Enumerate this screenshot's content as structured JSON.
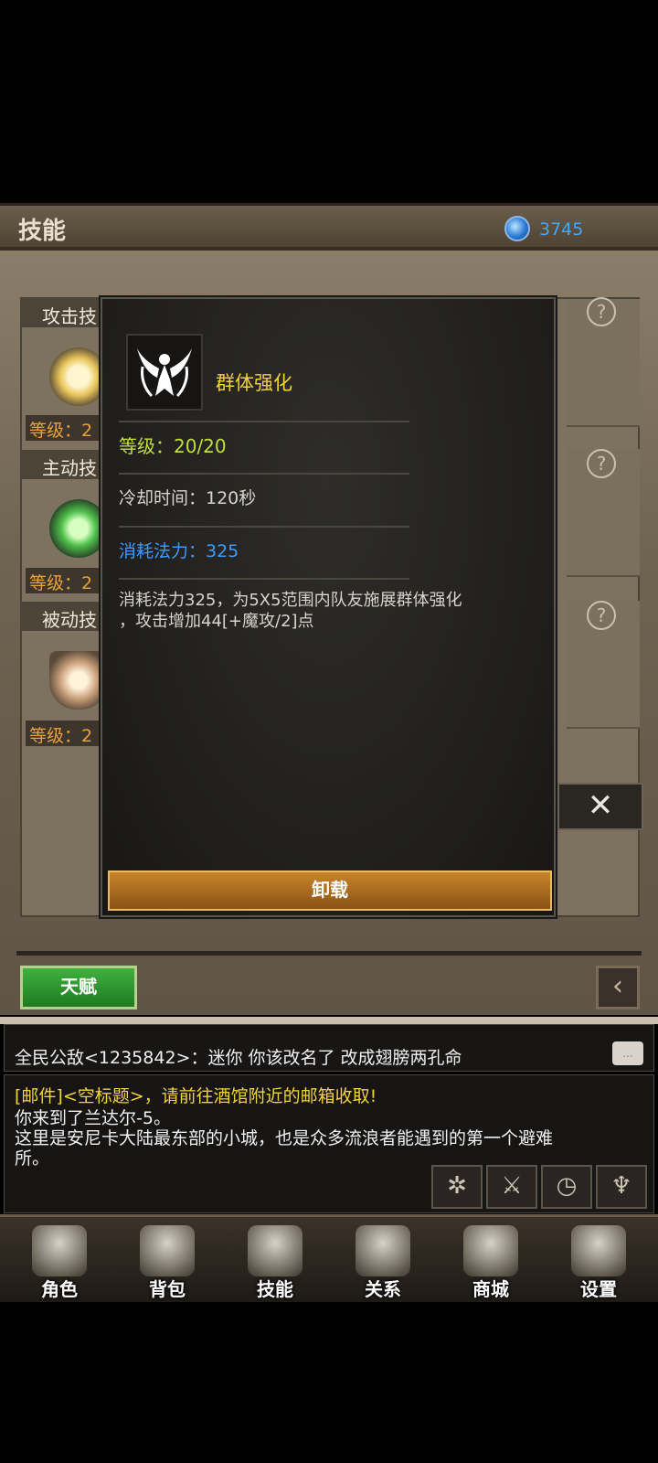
{
  "header": {
    "title": "技能",
    "gem_count": "3745"
  },
  "sections": [
    {
      "label": "攻击技",
      "level": "等级：2"
    },
    {
      "label": "主动技",
      "level": "等级：2"
    },
    {
      "label": "被动技",
      "level": "等级：2"
    }
  ],
  "popup": {
    "skill_name": "群体强化",
    "level": "等级：20/20",
    "cooldown": "冷却时间：120秒",
    "mana": "消耗法力：325",
    "description": "消耗法力325，为5X5范围内队友施展群体强化\n，攻击增加44[+魔攻/2]点",
    "unload_label": "卸载"
  },
  "close_label": "✕",
  "talent_label": "天赋",
  "chat": {
    "message": "全民公敌<1235842>：迷你  你该改名了 改成翅膀两孔命",
    "mail": "[邮件]<空标题>，请前往酒馆附近的邮箱收取!",
    "log": "你来到了兰达尔-5。\n这里是安尼卡大陆最东部的小城，也是众多流浪者能遇到的第一个避难\n所。"
  },
  "nav": [
    {
      "label": "角色",
      "icon": "helmet-icon"
    },
    {
      "label": "背包",
      "icon": "backpack-icon"
    },
    {
      "label": "技能",
      "icon": "spellbook-icon"
    },
    {
      "label": "关系",
      "icon": "handshake-icon"
    },
    {
      "label": "商城",
      "icon": "chest-icon"
    },
    {
      "label": "设置",
      "icon": "gear-icon"
    }
  ],
  "colors": {
    "accent_blue": "#3b9cff",
    "gold": "#f2d43a",
    "level_green": "#c4de3c",
    "orange": "#e7a23a"
  }
}
